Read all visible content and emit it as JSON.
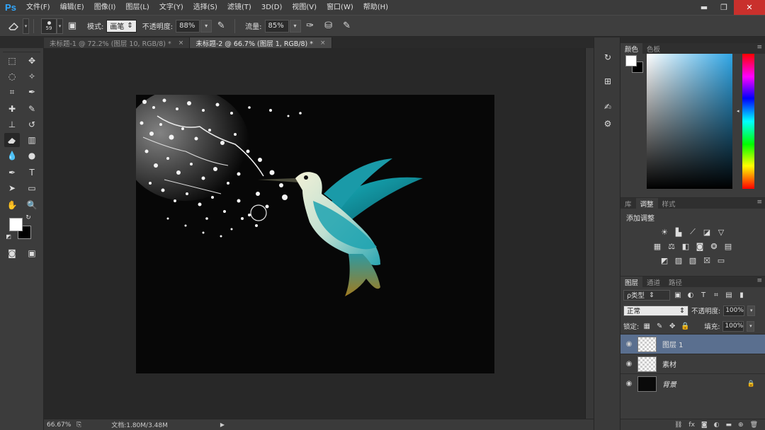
{
  "app": {
    "logo": "Ps"
  },
  "menu": [
    "文件(F)",
    "编辑(E)",
    "图像(I)",
    "图层(L)",
    "文字(Y)",
    "选择(S)",
    "滤镜(T)",
    "3D(D)",
    "视图(V)",
    "窗口(W)",
    "帮助(H)"
  ],
  "window_controls": {
    "minimize": "▬",
    "maximize": "❐",
    "close": "✕"
  },
  "options": {
    "brush_size": "59",
    "mode_label": "模式:",
    "mode_value": "画笔",
    "opacity_label": "不透明度:",
    "opacity_value": "88%",
    "flow_label": "流量:",
    "flow_value": "85%"
  },
  "doc_tabs": [
    {
      "label": "未标题-1 @ 72.2% (图层 10, RGB/8) *",
      "close": "×"
    },
    {
      "label": "未标题-2 @ 66.7% (图层 1, RGB/8) *",
      "close": "×"
    }
  ],
  "status": {
    "zoom": "66.67%",
    "doc_info": "文档:1.80M/3.48M",
    "play": "▶"
  },
  "color_panel": {
    "tabs": [
      "颜色",
      "色板"
    ]
  },
  "adjust_panel": {
    "tabs": [
      "库",
      "调整",
      "样式"
    ],
    "title": "添加调整"
  },
  "layers_panel": {
    "tabs": [
      "图层",
      "通道",
      "路径"
    ],
    "kind_filter": "ρ类型",
    "blend_mode": "正常",
    "opacity_label": "不透明度:",
    "opacity_value": "100%",
    "lock_label": "锁定:",
    "fill_label": "填充:",
    "fill_value": "100%",
    "layers": [
      {
        "name": "图层 1",
        "selected": true
      },
      {
        "name": "素材",
        "selected": false
      },
      {
        "name": "背景",
        "selected": false
      }
    ],
    "footer_icons": [
      "link",
      "fx",
      "mask",
      "adjustment",
      "group",
      "new-layer",
      "delete"
    ]
  },
  "colors": {
    "accent": "#31a8ff",
    "selected_layer": "#5a6f8f",
    "bird_teal": "#1fa7b4"
  }
}
